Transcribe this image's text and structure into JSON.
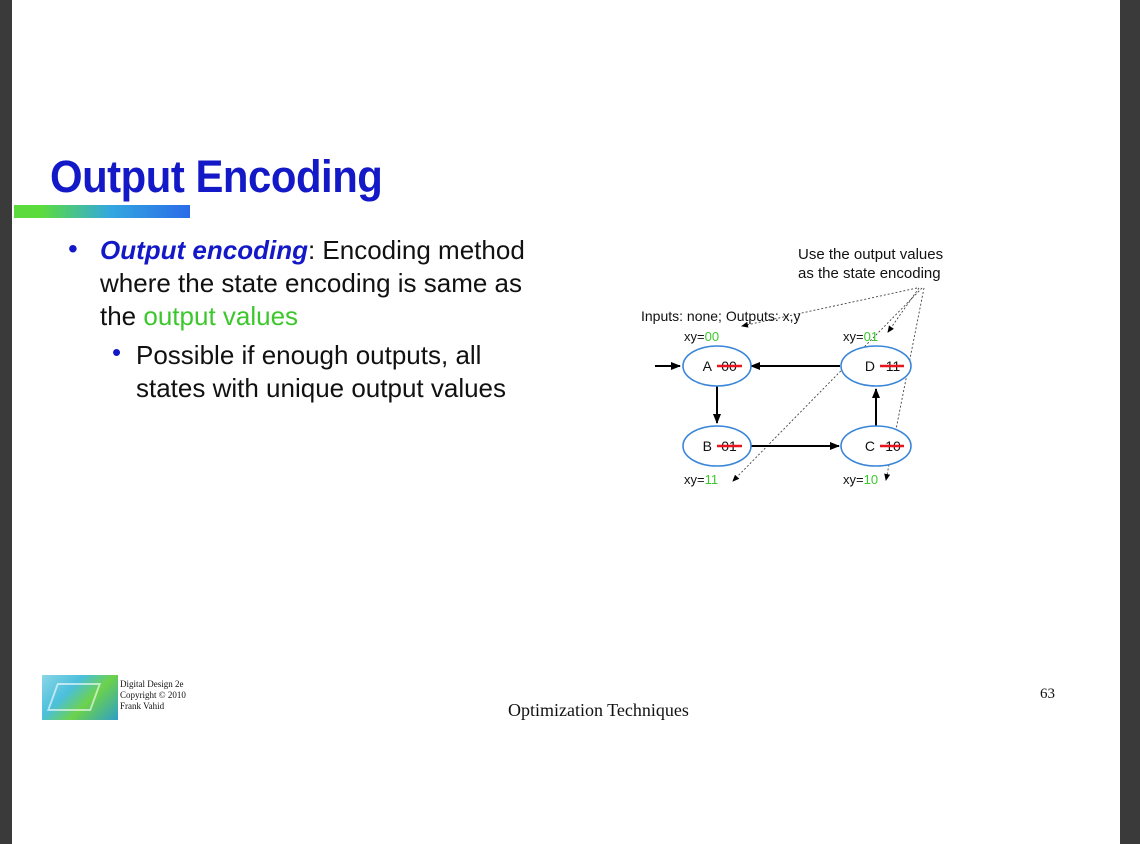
{
  "slide": {
    "title": "Output Encoding",
    "bullet1": {
      "term": "Output encoding",
      "text_before": ": Encoding method where the state encoding is same as the ",
      "highlight": "output values"
    },
    "bullet2": "Possible if enough outputs, all states with unique output values"
  },
  "diagram": {
    "callout_line1": "Use the output values",
    "callout_line2": "as the state encoding",
    "io_label": "Inputs: none; Outputs: x,y",
    "xy_prefix": "xy=",
    "states": [
      {
        "name": "A",
        "old_code": "00",
        "xy": "00"
      },
      {
        "name": "D",
        "old_code": "11",
        "xy": "01"
      },
      {
        "name": "B",
        "old_code": "01",
        "xy": "11"
      },
      {
        "name": "C",
        "old_code": "10",
        "xy": "10"
      }
    ]
  },
  "footer": {
    "book_line1": "Digital Design 2e",
    "book_line2": "Copyright © 2010",
    "book_line3": "Frank Vahid",
    "center": "Optimization Techniques",
    "page_number": "63"
  },
  "colors": {
    "title": "#1419c8",
    "highlight": "#3cc82c",
    "state_border": "#3a86d8",
    "strike": "#e8141e"
  }
}
